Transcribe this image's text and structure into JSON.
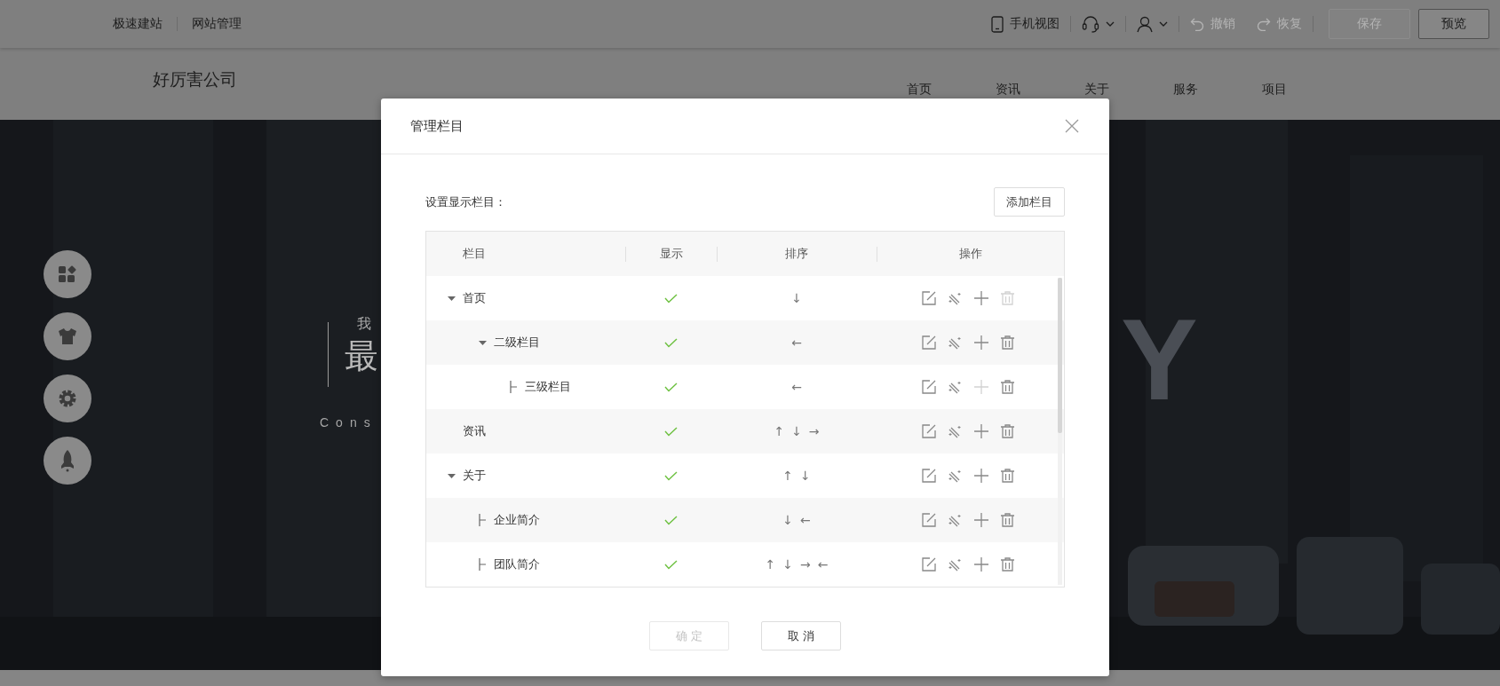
{
  "topbar": {
    "links": [
      "极速建站",
      "网站管理"
    ],
    "tools": [
      {
        "kind": "phone",
        "label": "手机视图",
        "disabled": false
      },
      {
        "kind": "headset",
        "menu": true,
        "disabled": false
      },
      {
        "kind": "user",
        "menu": true,
        "disabled": false
      },
      {
        "kind": "undo",
        "label": "撤销",
        "disabled": true
      },
      {
        "kind": "redo",
        "label": "恢复",
        "disabled": true
      }
    ],
    "buttons": [
      {
        "label": "保存",
        "disabled": true
      },
      {
        "label": "预览",
        "disabled": false
      }
    ]
  },
  "site_header": {
    "logo": "好厉害公司",
    "nav": [
      "首页",
      "资讯",
      "关于",
      "服务",
      "项目"
    ]
  },
  "hero": {
    "kind": "picture",
    "subtitle": "我",
    "title": "最",
    "tagline": "Cons",
    "title_end": "Y"
  },
  "side_tools": [
    {
      "kind": "apps"
    },
    {
      "kind": "shirt"
    },
    {
      "kind": "gear"
    },
    {
      "kind": "rocket"
    }
  ],
  "dialog": {
    "title": "管理栏目",
    "label": "设置显示栏目：",
    "add_button": "添加栏目",
    "columns": [
      "栏目",
      "显示",
      "排序",
      "操作"
    ],
    "rows": [
      {
        "name": "首页",
        "expanded": true,
        "visible": true,
        "sort": [
          "↓"
        ],
        "can_add": true,
        "can_delete": false,
        "children": [
          {
            "name": "二级栏目",
            "expanded": true,
            "visible": true,
            "sort": [
              "←"
            ],
            "can_add": true,
            "can_delete": true,
            "children": [
              {
                "name": "三级栏目",
                "visible": true,
                "sort": [
                  "←"
                ],
                "can_add": false,
                "can_delete": true
              }
            ]
          }
        ]
      },
      {
        "name": "资讯",
        "visible": true,
        "sort": [
          "↑",
          "↓",
          "→"
        ],
        "can_add": true,
        "can_delete": true
      },
      {
        "name": "关于",
        "expanded": true,
        "visible": true,
        "sort": [
          "↑",
          "↓"
        ],
        "can_add": true,
        "can_delete": true,
        "children": [
          {
            "name": "企业简介",
            "visible": true,
            "sort": [
              "↓",
              "←"
            ],
            "can_add": true,
            "can_delete": true
          },
          {
            "name": "团队简介",
            "visible": true,
            "sort": [
              "↑",
              "↓",
              "→",
              "←"
            ],
            "can_add": true,
            "can_delete": true
          }
        ]
      }
    ],
    "buttons": [
      {
        "label": "确 定",
        "disabled": true
      },
      {
        "label": "取 消",
        "disabled": false
      }
    ]
  }
}
